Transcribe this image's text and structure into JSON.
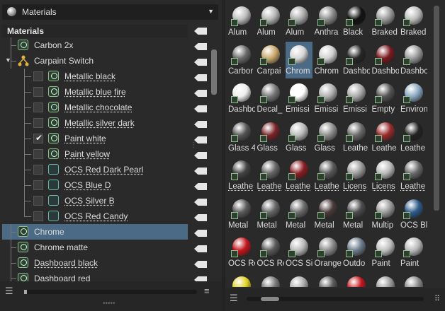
{
  "topbar": {
    "title": "Materials"
  },
  "tree": {
    "header": "Materials",
    "rows": [
      {
        "label": "Carbon 2x",
        "underline": false
      },
      {
        "label": "Carpaint Switch",
        "underline": false
      },
      {
        "label": "Metallic black",
        "underline": true
      },
      {
        "label": "Metallic blue fire",
        "underline": true
      },
      {
        "label": "Metallic chocolate",
        "underline": true
      },
      {
        "label": "Metallic silver dark",
        "underline": true
      },
      {
        "label": "Paint white",
        "underline": true
      },
      {
        "label": "Paint yellow",
        "underline": true
      },
      {
        "label": "OCS Red Dark Pearl",
        "underline": true
      },
      {
        "label": "OCS Blue D",
        "underline": true
      },
      {
        "label": "OCS Silver B",
        "underline": true
      },
      {
        "label": "OCS Red Candy",
        "underline": true
      },
      {
        "label": "Chrome",
        "underline": false
      },
      {
        "label": "Chrome matte",
        "underline": false
      },
      {
        "label": "Dashboard black",
        "underline": true
      },
      {
        "label": "Dashboard red",
        "underline": true
      }
    ]
  },
  "grid": {
    "labels": [
      "Alum",
      "Alum",
      "Alum",
      "Anthra",
      "Black",
      "Braked",
      "Braked",
      "Carbor",
      "Carpai",
      "Chrom",
      "Chrom",
      "Dashbo",
      "Dashbo",
      "Dashbo",
      "Dashbo",
      "Decal_",
      "Emissi",
      "Emissi",
      "Emissi",
      "Empty",
      "Environ",
      "Glass 4",
      "Glass",
      "Glass",
      "Glass",
      "Leathe",
      "Leathe",
      "Leathe",
      "Leathe",
      "Leathe",
      "Leathe",
      "Leathe",
      "Licens",
      "Licens",
      "Leathe",
      "Metal",
      "Metal",
      "Metal",
      "Metal",
      "Metal",
      "Multip",
      "OCS Bl",
      "OCS Re",
      "OCS Re",
      "OCS Si",
      "Orange",
      "Outdo",
      "Paint",
      "Paint",
      "",
      "",
      "",
      "",
      "",
      "",
      ""
    ],
    "colors": [
      "#bdbdbd",
      "#b5b5b5",
      "#a9a9a9",
      "#8a8a8a",
      "#111111",
      "#9a9a9a",
      "#bcbcbc",
      "#6a6a6a",
      "#c9a86a",
      "#d6d6d6",
      "#cfcfcf",
      "#262626",
      "#7a1a20",
      "#9a9a9a",
      "#ededed",
      "#777777",
      "#ffffff",
      "#b0b0b0",
      "#aaaaaa",
      "#555555",
      "#8aa6c0",
      "#555555",
      "#7a2328",
      "#bbbbbb",
      "#8d8d8d",
      "#6a6a6a",
      "#9b2a2a",
      "#222222",
      "#444444",
      "#666666",
      "#8b1d24",
      "#5a5a5a",
      "#9a9a9a",
      "#b9b9b9",
      "#6a6a6a",
      "#5a5a5a",
      "#666666",
      "#6b6b6b",
      "#4a3a3a",
      "#4d4d4d",
      "#999999",
      "#2e5a8a",
      "#c4161c",
      "#5a5a5a",
      "#b9b9b9",
      "#8a8a8a",
      "#6b7b8a",
      "#bfbfbf",
      "#b8b8b8",
      "#e0d020",
      "#777777",
      "#aaaaaa",
      "#5a5a5a",
      "#c4161c",
      "#999999",
      "#888888"
    ]
  }
}
